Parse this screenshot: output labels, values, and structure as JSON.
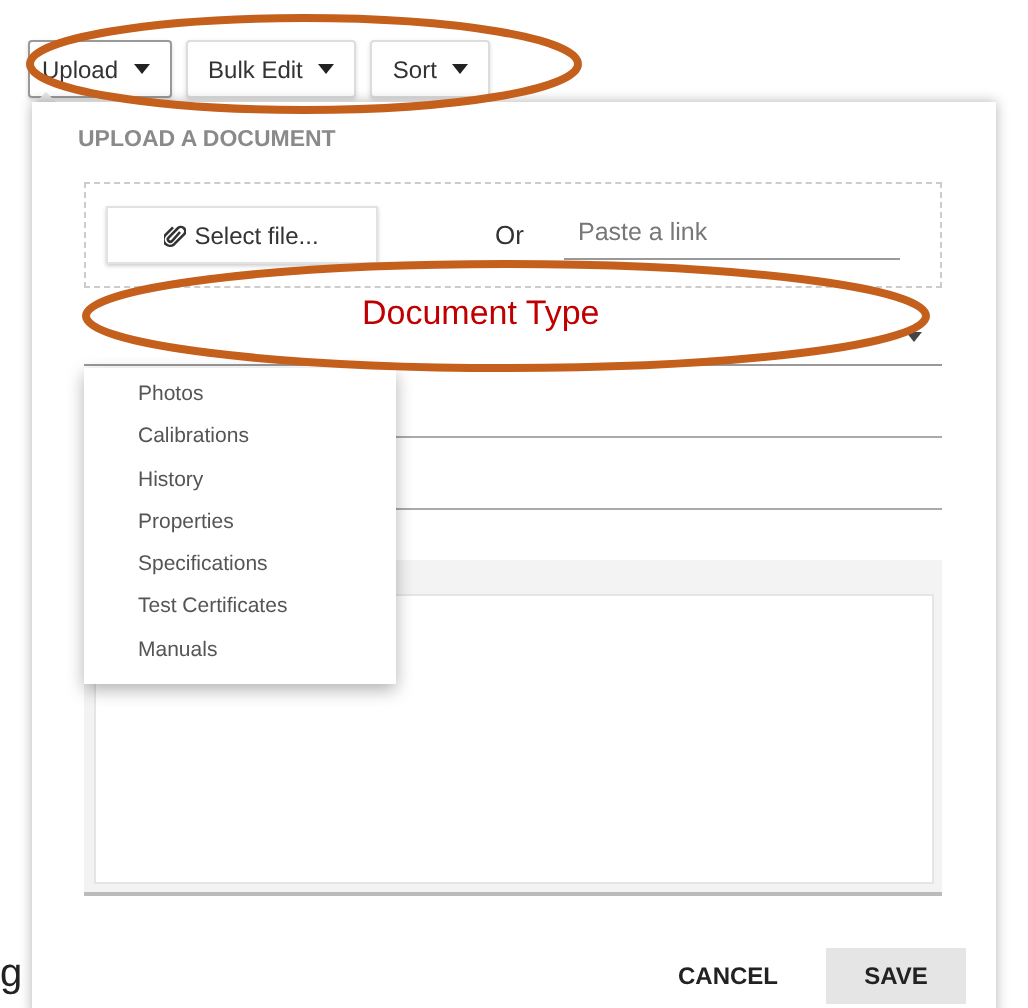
{
  "toolbar": [
    {
      "label": "Upload",
      "expanded": true
    },
    {
      "label": "Bulk Edit",
      "expanded": false
    },
    {
      "label": "Sort",
      "expanded": false
    }
  ],
  "dialog": {
    "title": "UPLOAD A DOCUMENT",
    "select_file_button": "Select file...",
    "or_label": "Or",
    "link_field": {
      "placeholder": "Paste a link"
    },
    "document_type_annotation": "Document Type",
    "type_menu": {
      "items": [
        "Photos",
        "Calibrations",
        "History",
        "Properties",
        "Specifications",
        "Test Certificates",
        "Manuals"
      ]
    },
    "buttons": [
      {
        "label": "CANCEL",
        "kind": "flat"
      },
      {
        "label": "SAVE",
        "kind": "raised"
      }
    ]
  },
  "background_text": "g"
}
